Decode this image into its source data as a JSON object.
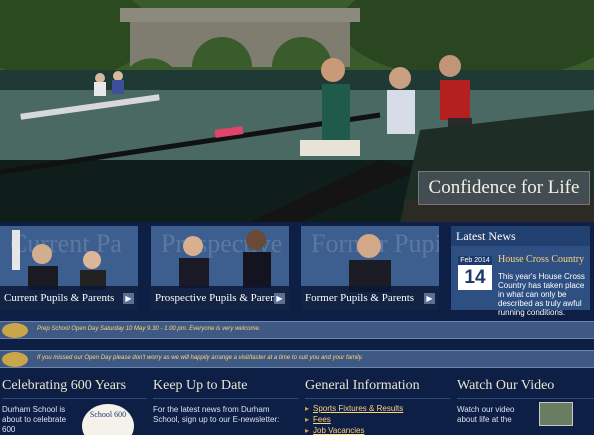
{
  "hero": {
    "tagline": "Confidence for Life",
    "image_description_icon": "rowing-photo"
  },
  "tiles": [
    {
      "ghost": "Current Pa",
      "label": "Current Pupils & Parents"
    },
    {
      "ghost": "Prospective",
      "label": "Prospective Pupils & Parents"
    },
    {
      "ghost": "Former Pupils &",
      "label": "Former Pupils & Parents"
    }
  ],
  "news": {
    "header": "Latest News",
    "month": "Feb 2014",
    "day": "14",
    "title": "House Cross Country",
    "text": "This year's House Cross Country has taken place in what can only be described as truly awful running conditions."
  },
  "banners": [
    {
      "message": "Prep School Open Day Saturday 10 May 9.30 - 1.00 pm. Everyone is very welcome."
    },
    {
      "message": "If you missed our Open Day please don't worry as we will happily arrange a visit/taster at a time to suit you and your family."
    }
  ],
  "columns": {
    "celebrating": {
      "title": "Celebrating 600 Years",
      "text": "Durham School is about to celebrate 600",
      "badge": "School 600"
    },
    "keep_up": {
      "title": "Keep Up to Date",
      "text": "For the latest news from Durham School, sign up to our E-newsletter:"
    },
    "general": {
      "title": "General Information",
      "links": [
        "Sports Fixtures & Results",
        "Fees",
        "Job Vacancies"
      ]
    },
    "video": {
      "title": "Watch Our Video",
      "text": "Watch our video about life at the"
    }
  },
  "colors": {
    "navy": "#0e1f45",
    "gold": "#ffd37a",
    "tile_blue": "#3d5f8f"
  }
}
